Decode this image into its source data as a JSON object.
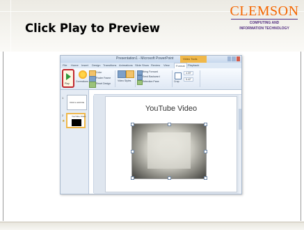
{
  "slide": {
    "title": "Click Play to Preview"
  },
  "logo": {
    "name": "CLEMSON",
    "line1": "COMPUTING AND",
    "line2": "INFORMATION TECHNOLOGY"
  },
  "powerpoint": {
    "window_title": "Presentation1 - Microsoft PowerPoint",
    "context_tab": "Video Tools",
    "tabs": [
      "File",
      "Home",
      "Insert",
      "Design",
      "Transitions",
      "Animations",
      "Slide Show",
      "Review",
      "View",
      "Format",
      "Playback"
    ],
    "ribbon": {
      "play_label": "Play",
      "corrections_label": "Corrections",
      "color_label": "Color",
      "poster_frame_label": "Poster Frame",
      "reset_design_label": "Reset Design",
      "video_styles_label": "Video Styles",
      "bring_forward_label": "Bring Forward",
      "send_backward_label": "Send Backward",
      "selection_pane_label": "Selection Pane",
      "crop_label": "Crop",
      "height_value": "4.09\"",
      "width_value": "5.42\"",
      "group_preview": "Preview",
      "group_adjust": "Adjust",
      "group_styles": "Video Styles",
      "group_arrange": "Arrange",
      "group_size": "Size"
    },
    "thumbnails": [
      {
        "number": "1",
        "caption": "Click to add title"
      },
      {
        "number": "2",
        "caption": "YouTube Video"
      }
    ],
    "slide_title": "YouTube Video"
  }
}
